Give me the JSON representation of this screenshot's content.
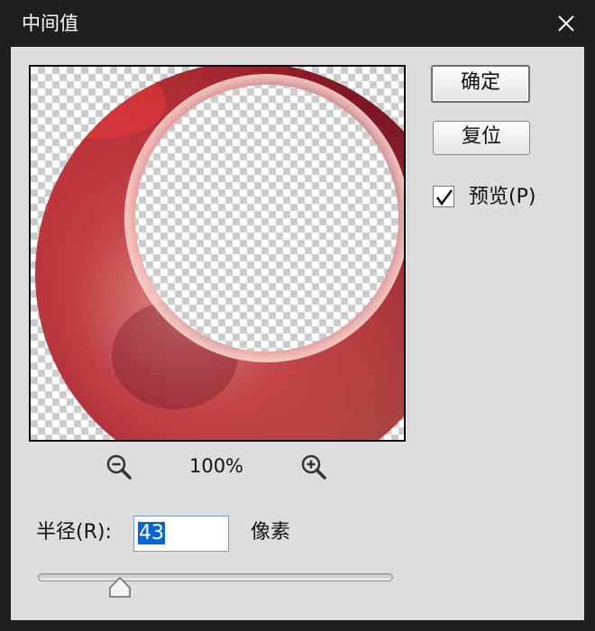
{
  "window": {
    "title": "中间值",
    "close_icon": "close-icon"
  },
  "buttons": {
    "ok_label": "确定",
    "reset_label": "复位"
  },
  "preview_option": {
    "label": "预览(P)",
    "checked": true
  },
  "zoom": {
    "level": "100%",
    "zoom_out_icon": "zoom-out-icon",
    "zoom_in_icon": "zoom-in-icon"
  },
  "radius": {
    "label": "半径(R):",
    "value": "43",
    "unit": "像素",
    "slider_fraction": 0.23
  },
  "colors": {
    "title_bar": "#1f1f1f",
    "dialog_background": "#dddddd",
    "selection": "#0a64d0",
    "ring_primary": "#b5363f",
    "ring_dark": "#7a1622",
    "ring_highlight": "#f5b0a8"
  }
}
